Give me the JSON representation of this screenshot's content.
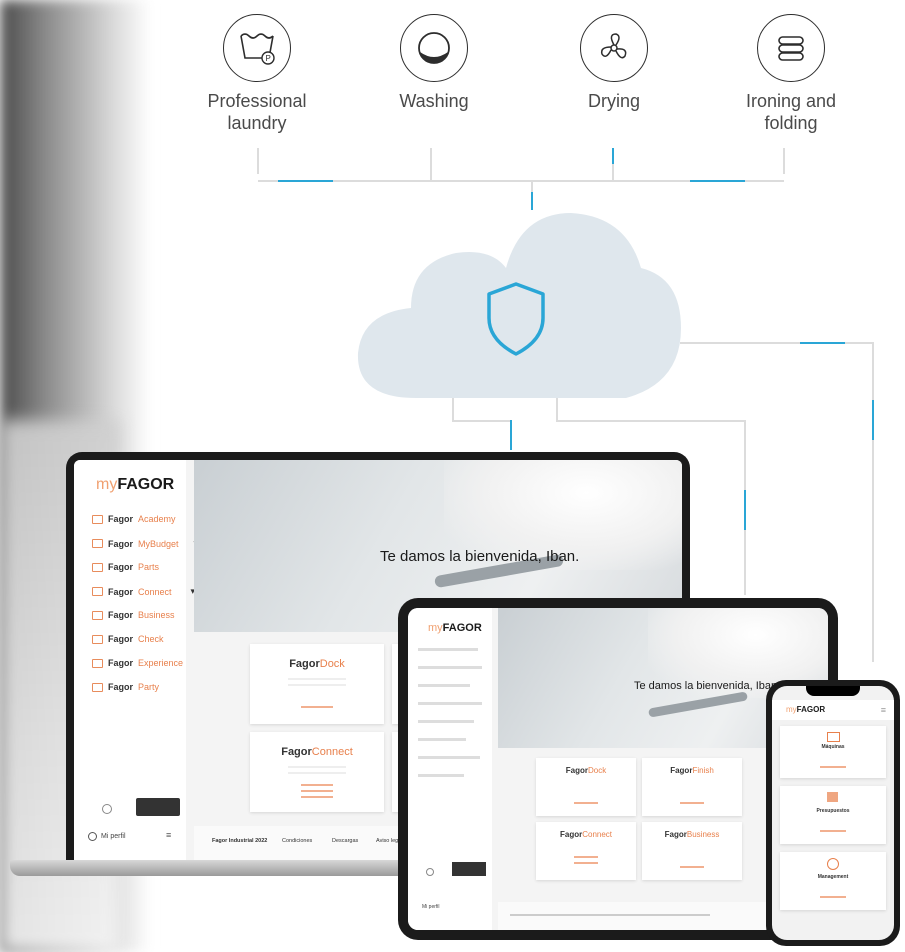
{
  "services": [
    {
      "label_line1": "Professional",
      "label_line2": "laundry",
      "icon": "laundry-tub-icon"
    },
    {
      "label_line1": "Washing",
      "label_line2": "",
      "icon": "washing-drum-icon"
    },
    {
      "label_line1": "Drying",
      "label_line2": "",
      "icon": "fan-icon"
    },
    {
      "label_line1": "Ironing and",
      "label_line2": "folding",
      "icon": "folded-linen-icon"
    }
  ],
  "cloud": {
    "icon": "shield-icon",
    "shield_color": "#2aa6d6",
    "cloud_color": "#dde6ec"
  },
  "laptop": {
    "brand_prefix": "my",
    "brand": "FAGOR",
    "menu": [
      {
        "prefix": "Fagor",
        "suffix": "Academy"
      },
      {
        "prefix": "Fagor",
        "suffix": "MyBudget"
      },
      {
        "prefix": "Fagor",
        "suffix": "Parts"
      },
      {
        "prefix": "Fagor",
        "suffix": "Connect"
      },
      {
        "prefix": "Fagor",
        "suffix": "Business"
      },
      {
        "prefix": "Fagor",
        "suffix": "Check"
      },
      {
        "prefix": "Fagor",
        "suffix": "Experience"
      },
      {
        "prefix": "Fagor",
        "suffix": "Party"
      }
    ],
    "welcome": "Te damos la bienvenida, Iban.",
    "cards": [
      {
        "prefix": "Fagor",
        "suffix": "Dock"
      },
      {
        "prefix": "Fagor",
        "suffix": "Connect"
      }
    ],
    "profile": "Mi perfil",
    "footer_links": [
      "Fagor Industrial 2022",
      "Condiciones",
      "Descargas",
      "Aviso legal"
    ]
  },
  "tablet": {
    "brand_prefix": "my",
    "brand": "FAGOR",
    "welcome": "Te damos la bienvenida, Iban.",
    "cards": [
      {
        "prefix": "Fagor",
        "suffix": "Dock"
      },
      {
        "prefix": "Fagor",
        "suffix": "Finish"
      },
      {
        "prefix": "Fagor",
        "suffix": "Connect"
      },
      {
        "prefix": "Fagor",
        "suffix": "Business"
      }
    ],
    "profile": "Mi perfil"
  },
  "phone": {
    "brand_prefix": "my",
    "brand": "FAGOR",
    "cards": [
      {
        "title": "Máquinas"
      },
      {
        "title": "Presupuestos"
      },
      {
        "title": "Management"
      }
    ]
  }
}
